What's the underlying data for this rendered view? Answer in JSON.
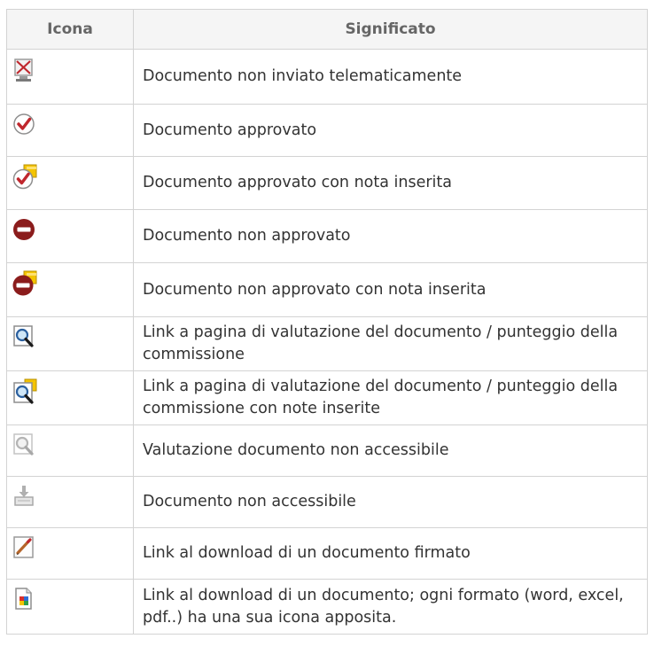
{
  "table": {
    "headers": {
      "icon": "Icona",
      "meaning": "Significato"
    },
    "rows": [
      {
        "icon": "not-sent-icon",
        "meaning": "Documento non inviato telematicamente"
      },
      {
        "icon": "approved-icon",
        "meaning": "Documento approvato"
      },
      {
        "icon": "approved-note-icon",
        "meaning": "Documento approvato con nota inserita"
      },
      {
        "icon": "not-approved-icon",
        "meaning": "Documento non approvato"
      },
      {
        "icon": "not-approved-note-icon",
        "meaning": "Documento non approvato con nota inserita"
      },
      {
        "icon": "evaluation-link-icon",
        "meaning": "Link a pagina di valutazione del documento / punteggio della commissione"
      },
      {
        "icon": "evaluation-link-note-icon",
        "meaning": "Link a pagina di valutazione del documento / punteggio della commissione con note inserite"
      },
      {
        "icon": "evaluation-disabled-icon",
        "meaning": "Valutazione documento non accessibile"
      },
      {
        "icon": "download-disabled-icon",
        "meaning": "Documento non accessibile"
      },
      {
        "icon": "signed-download-icon",
        "meaning": "Link al download di un documento firmato"
      },
      {
        "icon": "document-download-icon",
        "meaning": "Link al download di un documento; ogni formato (word, excel, pdf..) ha una sua icona apposita."
      }
    ]
  },
  "colors": {
    "border": "#d3d3d3",
    "header_bg": "#f5f5f5",
    "header_text": "#666666",
    "text": "#333333",
    "check_red": "#c0272d",
    "stop_red": "#8b1c1c",
    "note_yellow": "#f4c400"
  }
}
